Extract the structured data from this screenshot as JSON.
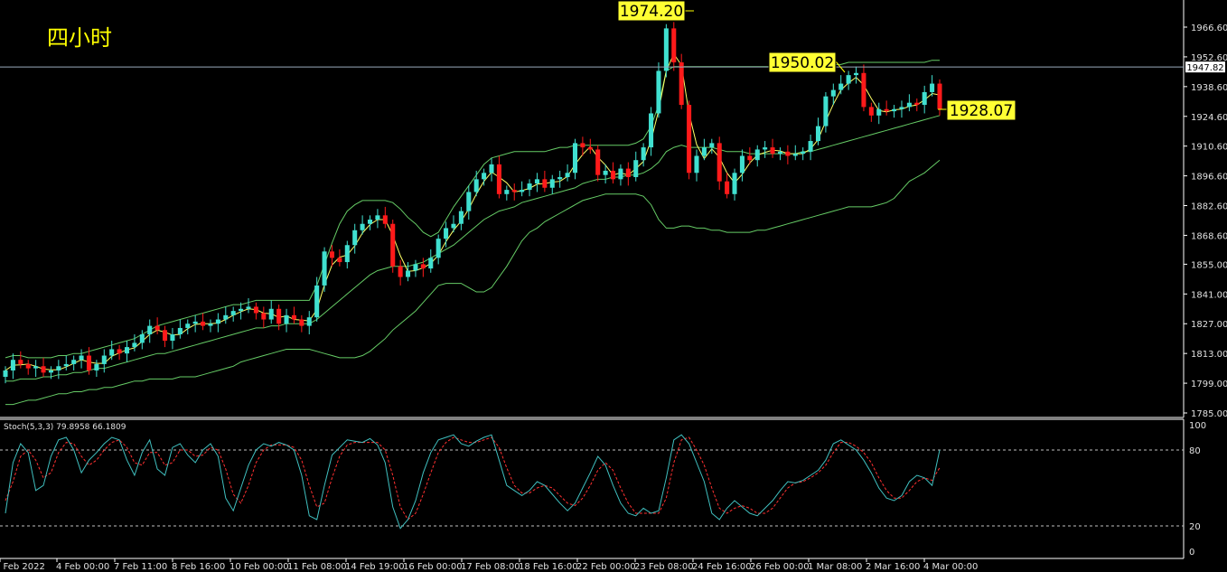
{
  "chart_data": [
    {
      "type": "candlestick",
      "title": "四小时",
      "ylim": [
        1785.0,
        1974.0
      ],
      "y_ticks": [
        "1966.60",
        "1952.60",
        "1938.60",
        "1924.60",
        "1910.60",
        "1896.60",
        "1882.60",
        "1868.60",
        "1855.00",
        "1841.00",
        "1827.00",
        "1813.00",
        "1799.00",
        "1785.00"
      ],
      "x_ticks": [
        "2 Feb 2022",
        "4 Feb 00:00",
        "7 Feb 11:00",
        "8 Feb 16:00",
        "10 Feb 00:00",
        "11 Feb 08:00",
        "14 Feb 19:00",
        "16 Feb 00:00",
        "17 Feb 08:00",
        "18 Feb 16:00",
        "22 Feb 00:00",
        "23 Feb 08:00",
        "24 Feb 16:00",
        "26 Feb 00:00",
        "1 Mar 08:00",
        "2 Mar 16:00",
        "4 Mar 00:00"
      ],
      "current_price": "1947.82",
      "annotations": [
        "1974.20",
        "1950.02",
        "1928.07"
      ],
      "colors": {
        "up": "#40e0d0",
        "down": "#ff1a1a",
        "band": "#66cc66",
        "ma": "#ffff66",
        "price_line": "#99aabb"
      },
      "closes": [
        1805,
        1810,
        1808,
        1806,
        1807,
        1804,
        1805,
        1807,
        1808,
        1810,
        1812,
        1805,
        1808,
        1812,
        1815,
        1813,
        1816,
        1818,
        1822,
        1826,
        1824,
        1819,
        1822,
        1825,
        1827,
        1828,
        1826,
        1827,
        1829,
        1831,
        1833,
        1834,
        1835,
        1832,
        1829,
        1834,
        1827,
        1831,
        1829,
        1826,
        1830,
        1845,
        1861,
        1858,
        1856,
        1864,
        1871,
        1874,
        1876,
        1878,
        1874,
        1854,
        1849,
        1852,
        1855,
        1853,
        1858,
        1867,
        1872,
        1874,
        1880,
        1889,
        1895,
        1898,
        1902,
        1888,
        1890,
        1889,
        1890,
        1893,
        1895,
        1891,
        1895,
        1896,
        1898,
        1912,
        1910,
        1909,
        1897,
        1899,
        1895,
        1900,
        1896,
        1904,
        1910,
        1926,
        1946,
        1966,
        1950,
        1930,
        1898,
        1906,
        1910,
        1912,
        1894,
        1888,
        1898,
        1906,
        1904,
        1909,
        1910,
        1907,
        1908,
        1906,
        1907,
        1908,
        1913,
        1920,
        1934,
        1937,
        1940,
        1944,
        1945,
        1929,
        1925,
        1928,
        1927,
        1928,
        1929,
        1931,
        1930,
        1936,
        1940,
        1928
      ],
      "bollinger_upper": [
        1811,
        1812,
        1812,
        1811,
        1811,
        1811,
        1811,
        1812,
        1812,
        1813,
        1813,
        1814,
        1815,
        1816,
        1817,
        1818,
        1819,
        1820,
        1822,
        1824,
        1826,
        1827,
        1828,
        1829,
        1830,
        1831,
        1832,
        1833,
        1834,
        1835,
        1836,
        1836,
        1837,
        1838,
        1838,
        1838,
        1838,
        1838,
        1838,
        1838,
        1838,
        1845,
        1855,
        1865,
        1874,
        1880,
        1883,
        1885,
        1885,
        1885,
        1885,
        1884,
        1881,
        1877,
        1874,
        1870,
        1868,
        1870,
        1876,
        1882,
        1887,
        1892,
        1897,
        1902,
        1905,
        1906,
        1907,
        1908,
        1908,
        1908,
        1908,
        1908,
        1909,
        1910,
        1910,
        1911,
        1911,
        1911,
        1911,
        1911,
        1911,
        1911,
        1911,
        1912,
        1914,
        1920,
        1930,
        1946,
        1948,
        1948,
        1948,
        1948,
        1948,
        1948,
        1948,
        1948,
        1948,
        1948,
        1948,
        1948,
        1948,
        1948,
        1948,
        1948,
        1948,
        1948,
        1948,
        1948,
        1948,
        1949,
        1949,
        1950,
        1950,
        1950,
        1950,
        1950,
        1950,
        1950,
        1950,
        1950,
        1950,
        1950,
        1951,
        1951
      ],
      "bollinger_middle": [
        1800,
        1800,
        1801,
        1801,
        1801,
        1802,
        1802,
        1803,
        1803,
        1804,
        1804,
        1805,
        1806,
        1806,
        1807,
        1808,
        1809,
        1810,
        1811,
        1812,
        1813,
        1813,
        1814,
        1815,
        1816,
        1817,
        1818,
        1819,
        1820,
        1821,
        1822,
        1823,
        1824,
        1825,
        1825,
        1826,
        1826,
        1827,
        1827,
        1827,
        1827,
        1829,
        1832,
        1835,
        1838,
        1841,
        1844,
        1847,
        1850,
        1852,
        1853,
        1854,
        1854,
        1854,
        1855,
        1856,
        1858,
        1860,
        1862,
        1864,
        1867,
        1870,
        1873,
        1876,
        1878,
        1880,
        1881,
        1882,
        1884,
        1885,
        1886,
        1887,
        1888,
        1889,
        1890,
        1891,
        1893,
        1894,
        1895,
        1895,
        1896,
        1896,
        1897,
        1897,
        1898,
        1900,
        1903,
        1908,
        1910,
        1911,
        1910,
        1910,
        1910,
        1910,
        1909,
        1908,
        1908,
        1908,
        1907,
        1907,
        1907,
        1907,
        1907,
        1907,
        1907,
        1908,
        1908,
        1909,
        1910,
        1911,
        1912,
        1913,
        1914,
        1915,
        1916,
        1917,
        1918,
        1919,
        1920,
        1921,
        1922,
        1923,
        1924,
        1925
      ],
      "bollinger_lower": [
        1789,
        1789,
        1790,
        1791,
        1791,
        1792,
        1793,
        1794,
        1794,
        1795,
        1795,
        1796,
        1796,
        1797,
        1797,
        1798,
        1799,
        1800,
        1800,
        1801,
        1801,
        1801,
        1801,
        1802,
        1802,
        1802,
        1803,
        1804,
        1805,
        1806,
        1807,
        1809,
        1810,
        1811,
        1812,
        1813,
        1814,
        1815,
        1815,
        1815,
        1815,
        1814,
        1813,
        1812,
        1811,
        1811,
        1811,
        1812,
        1814,
        1817,
        1820,
        1824,
        1827,
        1830,
        1833,
        1837,
        1841,
        1845,
        1846,
        1846,
        1846,
        1844,
        1842,
        1842,
        1844,
        1849,
        1854,
        1860,
        1866,
        1870,
        1872,
        1875,
        1877,
        1879,
        1881,
        1883,
        1885,
        1886,
        1887,
        1888,
        1888,
        1888,
        1888,
        1888,
        1887,
        1883,
        1876,
        1872,
        1872,
        1873,
        1873,
        1872,
        1872,
        1871,
        1871,
        1870,
        1870,
        1870,
        1870,
        1871,
        1871,
        1872,
        1873,
        1874,
        1875,
        1876,
        1877,
        1878,
        1879,
        1880,
        1881,
        1882,
        1882,
        1882,
        1882,
        1883,
        1884,
        1886,
        1890,
        1894,
        1896,
        1898,
        1901,
        1904
      ],
      "stochastic": {
        "label": "Stoch(5,3,3) 79.8958 66.1809",
        "ylim": [
          0,
          100
        ],
        "levels": [
          20,
          80
        ],
        "y_ticks": [
          "100",
          "80",
          "20",
          "0"
        ],
        "colors": {
          "k": "#40c0c0",
          "d": "#ff3030"
        },
        "k": [
          30,
          70,
          85,
          78,
          48,
          52,
          75,
          88,
          90,
          80,
          62,
          72,
          78,
          85,
          90,
          88,
          72,
          60,
          78,
          88,
          65,
          60,
          82,
          85,
          76,
          70,
          80,
          85,
          75,
          42,
          32,
          50,
          68,
          80,
          85,
          83,
          86,
          84,
          80,
          60,
          28,
          25,
          52,
          76,
          82,
          88,
          87,
          86,
          89,
          84,
          70,
          35,
          18,
          25,
          40,
          62,
          78,
          88,
          90,
          92,
          85,
          83,
          87,
          90,
          92,
          72,
          52,
          48,
          44,
          48,
          55,
          52,
          45,
          38,
          32,
          38,
          50,
          62,
          75,
          68,
          52,
          38,
          30,
          28,
          34,
          30,
          32,
          58,
          88,
          92,
          85,
          70,
          55,
          30,
          25,
          34,
          40,
          35,
          30,
          28,
          34,
          40,
          48,
          55,
          54,
          56,
          60,
          64,
          72,
          85,
          88,
          84,
          80,
          72,
          62,
          50,
          42,
          40,
          44,
          55,
          60,
          58,
          52,
          80
        ],
        "d": [
          40,
          55,
          75,
          80,
          72,
          58,
          62,
          78,
          86,
          85,
          75,
          68,
          72,
          80,
          86,
          88,
          82,
          70,
          68,
          78,
          78,
          68,
          70,
          80,
          80,
          75,
          76,
          82,
          80,
          65,
          45,
          38,
          52,
          70,
          80,
          84,
          84,
          84,
          82,
          72,
          52,
          35,
          38,
          58,
          75,
          84,
          86,
          86,
          86,
          86,
          80,
          60,
          35,
          25,
          30,
          45,
          62,
          78,
          86,
          90,
          88,
          86,
          86,
          88,
          90,
          82,
          66,
          52,
          46,
          46,
          50,
          52,
          50,
          44,
          38,
          36,
          42,
          52,
          64,
          70,
          64,
          50,
          38,
          30,
          30,
          30,
          30,
          42,
          70,
          88,
          90,
          80,
          68,
          50,
          34,
          30,
          34,
          36,
          34,
          30,
          30,
          34,
          42,
          50,
          54,
          55,
          58,
          62,
          68,
          78,
          86,
          86,
          83,
          78,
          70,
          58,
          48,
          42,
          42,
          48,
          55,
          58,
          56,
          66
        ]
      }
    }
  ]
}
